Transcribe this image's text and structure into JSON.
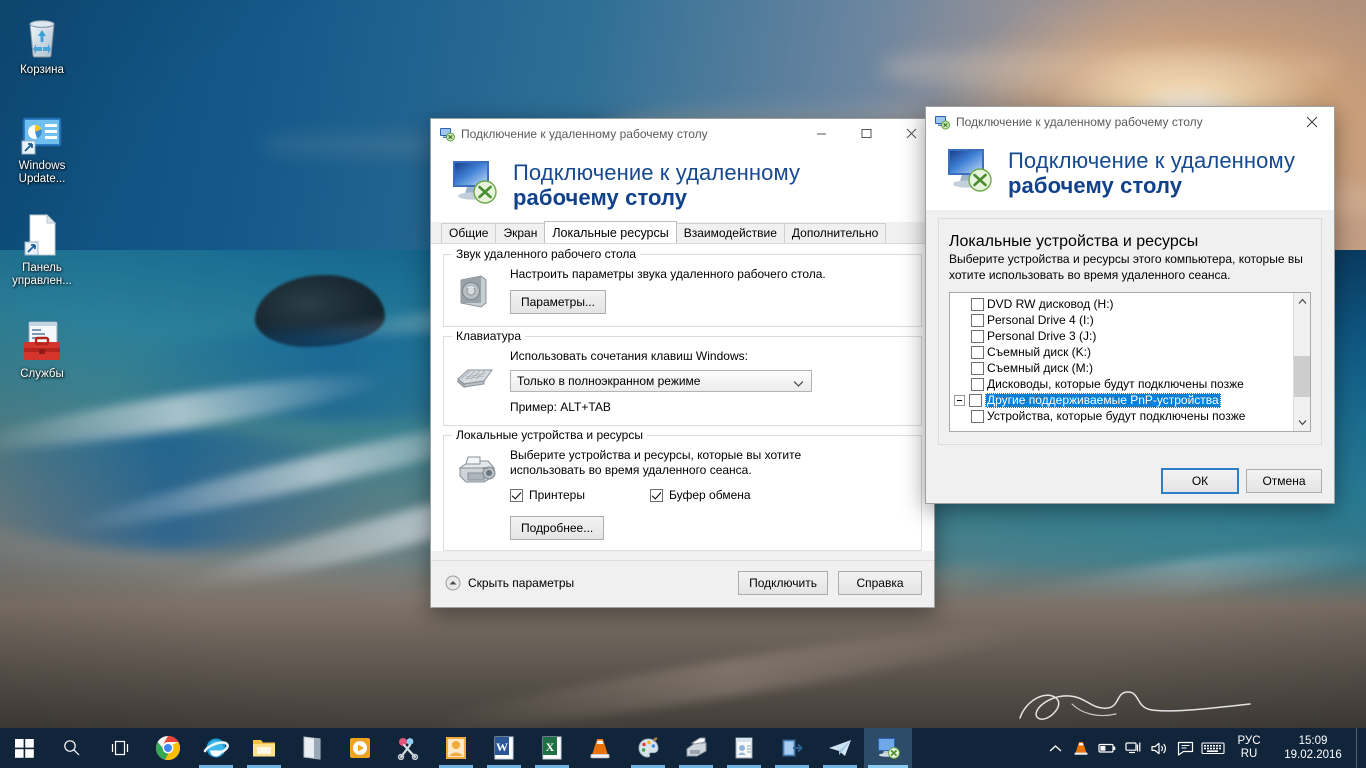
{
  "desktop": {
    "icons": [
      {
        "name": "recycle-bin",
        "label": "Корзина"
      },
      {
        "name": "windows-update",
        "label": "Windows\nUpdate..."
      },
      {
        "name": "control-panel",
        "label": "Панель\nуправлен..."
      },
      {
        "name": "services",
        "label": "Службы"
      }
    ],
    "watermark": "signature"
  },
  "main_window": {
    "title": "Подключение к удаленному рабочему столу",
    "icon": "remote-desktop-icon",
    "banner": {
      "line1": "Подключение к удаленному",
      "line2": "рабочему столу"
    },
    "titlebar_buttons": {
      "minimize": "minimize-icon",
      "maximize": "maximize-icon",
      "close": "close-icon"
    },
    "tabs": [
      {
        "label": "Общие",
        "active": false
      },
      {
        "label": "Экран",
        "active": false
      },
      {
        "label": "Локальные ресурсы",
        "active": true
      },
      {
        "label": "Взаимодействие",
        "active": false
      },
      {
        "label": "Дополнительно",
        "active": false
      }
    ],
    "groups": {
      "audio": {
        "title": "Звук удаленного рабочего стола",
        "icon": "speaker-icon",
        "description": "Настроить параметры звука удаленного рабочего стола.",
        "button": "Параметры..."
      },
      "keyboard": {
        "title": "Клавиатура",
        "icon": "keyboard-icon",
        "label": "Использовать сочетания клавиш Windows:",
        "combo_value": "Только в полноэкранном режиме",
        "example": "Пример: ALT+TAB"
      },
      "devices": {
        "title": "Локальные устройства и ресурсы",
        "icon": "printer-devices-icon",
        "description_line1": "Выберите устройства и ресурсы, которые вы хотите",
        "description_line2": "использовать во время удаленного сеанса.",
        "checkboxes": [
          {
            "label": "Принтеры",
            "checked": true
          },
          {
            "label": "Буфер обмена",
            "checked": true
          }
        ],
        "button": "Подробнее..."
      }
    },
    "footer": {
      "hide_options": "Скрыть параметры",
      "hide_options_icon": "chevron-up-circle-icon",
      "connect_button": "Подключить",
      "help_button": "Справка"
    }
  },
  "sub_window": {
    "title": "Подключение к удаленному рабочему столу",
    "icon": "remote-desktop-icon",
    "close_icon": "close-icon",
    "banner": {
      "line1": "Подключение к удаленному",
      "line2": "рабочему столу"
    },
    "group_title": "Локальные устройства и ресурсы",
    "description_line1": "Выберите устройства и ресурсы этого компьютера, которые вы",
    "description_line2": "хотите использовать во время удаленного сеанса.",
    "list_items": [
      {
        "label": "DVD RW дисковод (H:)",
        "checked": false,
        "indent": 1,
        "expander": false,
        "selected": false
      },
      {
        "label": "Personal Drive 4 (I:)",
        "checked": false,
        "indent": 1,
        "expander": false,
        "selected": false
      },
      {
        "label": "Personal Drive 3 (J:)",
        "checked": false,
        "indent": 1,
        "expander": false,
        "selected": false
      },
      {
        "label": "Съемный диск (K:)",
        "checked": false,
        "indent": 1,
        "expander": false,
        "selected": false
      },
      {
        "label": "Съемный диск (M:)",
        "checked": false,
        "indent": 1,
        "expander": false,
        "selected": false
      },
      {
        "label": "Дисководы, которые будут подключены позже",
        "checked": false,
        "indent": 1,
        "expander": false,
        "selected": false
      },
      {
        "label": "Другие поддерживаемые PnP-устройства",
        "checked": false,
        "indent": 0,
        "expander": true,
        "selected": true
      },
      {
        "label": "Устройства, которые будут подключены позже",
        "checked": false,
        "indent": 1,
        "expander": false,
        "selected": false
      }
    ],
    "scrollbar": {
      "up_icon": "chevron-up-icon",
      "down_icon": "chevron-down-icon",
      "thumb_top_pct": 44,
      "thumb_height_pct": 40
    },
    "ok_button": "ОК",
    "cancel_button": "Отмена"
  },
  "taskbar": {
    "start_icon": "windows-logo-icon",
    "tools": [
      {
        "name": "search-icon"
      },
      {
        "name": "task-view-icon"
      }
    ],
    "apps": [
      {
        "name": "chrome-icon",
        "running": false,
        "active": false
      },
      {
        "name": "internet-explorer-icon",
        "running": true,
        "active": false
      },
      {
        "name": "file-explorer-icon",
        "running": true,
        "active": false
      },
      {
        "name": "onenote-icon",
        "running": false,
        "active": false
      },
      {
        "name": "media-player-icon",
        "running": false,
        "active": false
      },
      {
        "name": "snipping-tool-icon",
        "running": false,
        "active": false
      },
      {
        "name": "outlook-icon",
        "running": true,
        "active": false
      },
      {
        "name": "word-icon",
        "running": true,
        "active": false
      },
      {
        "name": "excel-icon",
        "running": true,
        "active": false
      },
      {
        "name": "vlc-icon",
        "running": false,
        "active": false
      },
      {
        "name": "paint-icon",
        "running": true,
        "active": false
      },
      {
        "name": "scanner-icon",
        "running": true,
        "active": false
      },
      {
        "name": "contacts-icon",
        "running": true,
        "active": false
      },
      {
        "name": "logoff-icon",
        "running": true,
        "active": false
      },
      {
        "name": "telegram-icon",
        "running": true,
        "active": false
      },
      {
        "name": "remote-desktop-icon",
        "running": true,
        "active": true
      }
    ],
    "tray_icons": [
      {
        "name": "show-hidden-icons-chevron"
      },
      {
        "name": "vlc-tray-icon"
      },
      {
        "name": "battery-icon"
      },
      {
        "name": "network-icon"
      },
      {
        "name": "volume-icon"
      },
      {
        "name": "action-center-icon"
      },
      {
        "name": "touch-keyboard-icon"
      }
    ],
    "language": {
      "line1": "РУС",
      "line2": "RU"
    },
    "clock": {
      "time": "15:09",
      "date": "19.02.2016"
    }
  }
}
